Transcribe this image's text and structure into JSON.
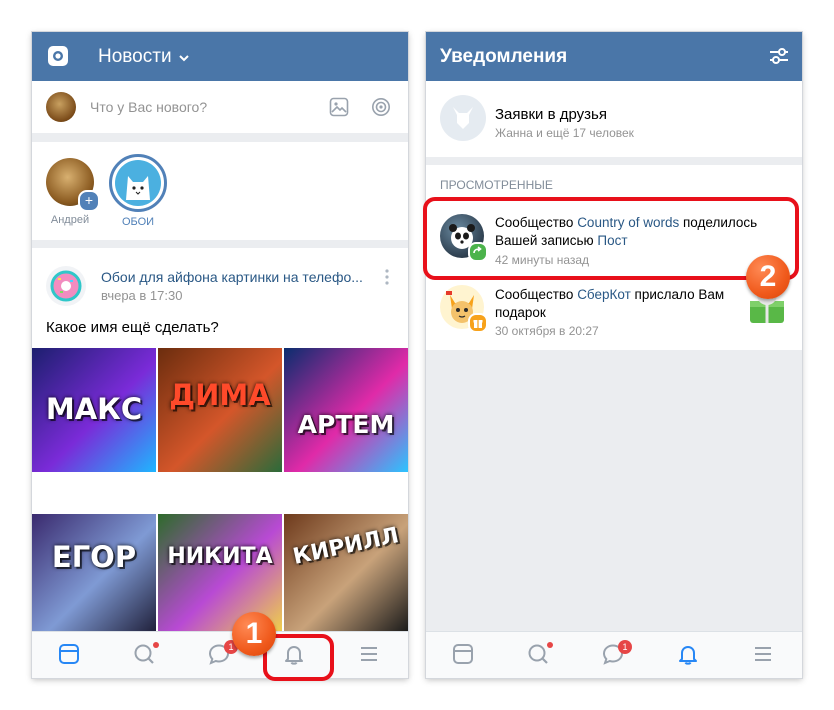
{
  "left_screen": {
    "header": {
      "title": "Новости",
      "camera_icon": "camera-icon",
      "chevron_icon": "chevron-down-icon"
    },
    "composer": {
      "placeholder": "Что у Вас нового?",
      "photo_icon": "image-icon",
      "live_icon": "broadcast-icon"
    },
    "stories": [
      {
        "name": "Андрей"
      },
      {
        "name": "ОБОИ"
      }
    ],
    "post": {
      "author": "Обои для айфона картинки на телефо...",
      "time": "вчера в 17:30",
      "text": "Какое имя ещё сделать?",
      "tiles": [
        {
          "label": "МАКС",
          "colors": [
            "#1c1f6e",
            "#7a2bd8",
            "#1fb6ff"
          ]
        },
        {
          "label": "ДИМА",
          "colors": [
            "#6b2d0e",
            "#d4562a",
            "#2a6b3a"
          ]
        },
        {
          "label": "АРТЕМ",
          "colors": [
            "#0a2d6e",
            "#e02aa8",
            "#2bc4ff"
          ]
        },
        {
          "label": "ЕГОР",
          "colors": [
            "#3a2a6e",
            "#7f9ad4",
            "#20203a"
          ]
        },
        {
          "label": "НИКИТА",
          "colors": [
            "#2d6b2a",
            "#b84ad4",
            "#f0d04a"
          ]
        },
        {
          "label": "КИРИЛЛ",
          "colors": [
            "#6e3a1c",
            "#c8a27a",
            "#1a1a1a"
          ]
        }
      ]
    },
    "tabbar": {
      "icons": [
        "news-icon",
        "search-icon",
        "messages-icon",
        "bell-icon",
        "menu-icon"
      ],
      "messages_badge": "1"
    },
    "step_number": "1"
  },
  "right_screen": {
    "header": {
      "title": "Уведомления",
      "filter_icon": "settings-sliders-icon"
    },
    "friend_requests": {
      "title": "Заявки в друзья",
      "subtitle": "Жанна и ещё 17 человек"
    },
    "section_title": "ПРОСМОТРЕННЫЕ",
    "notifications": [
      {
        "prefix": "Сообщество ",
        "community": "Country of words",
        "middle": " поделилось Вашей записью ",
        "object": "Пост",
        "suffix": "",
        "time": "42 минуты назад"
      },
      {
        "prefix": "Сообщество ",
        "community": "СберКот",
        "middle": " прислало Вам подарок",
        "object": "",
        "suffix": "",
        "time": "30 октября в 20:27"
      }
    ],
    "tabbar": {
      "icons": [
        "news-icon",
        "search-icon",
        "messages-icon",
        "bell-icon",
        "menu-icon"
      ],
      "messages_badge": "1"
    },
    "step_number": "2"
  },
  "colors": {
    "header": "#4a76a8",
    "link": "#2a5885",
    "highlight": "#e8101a",
    "badge": "#f05a1c"
  }
}
